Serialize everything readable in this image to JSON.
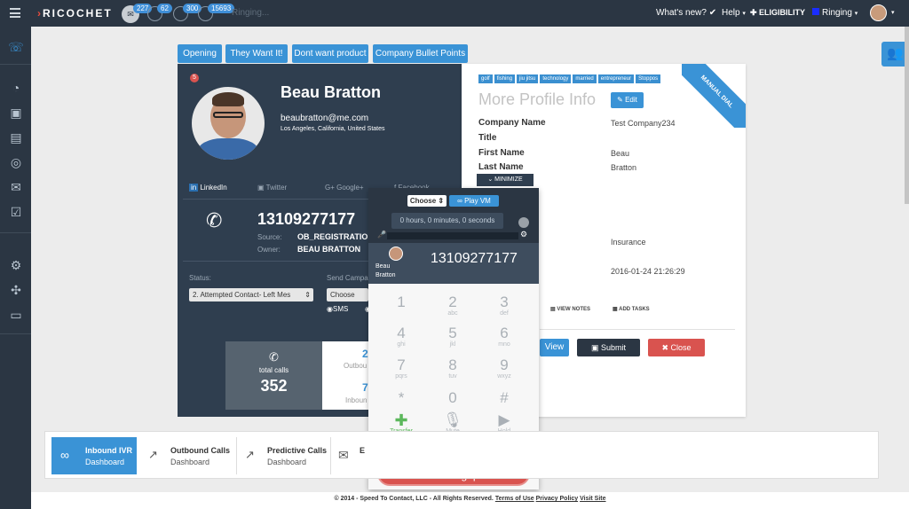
{
  "topbar": {
    "logo": "RICOCHET",
    "status_text": "Ringing...",
    "badges": [
      "227",
      "62",
      "300",
      "15693"
    ],
    "whats_new": "What's new?",
    "help": "Help",
    "eligibility": "ELIGIBILITY",
    "ringing": "Ringing"
  },
  "tabs": [
    "Opening",
    "They Want It!",
    "Dont want product",
    "Company Bullet Points"
  ],
  "profile": {
    "notif": "5",
    "name": "Beau Bratton",
    "email": "beaubratton@me.com",
    "location": "Los Angeles, California, United States",
    "socials": [
      "LinkedIn",
      "Twitter",
      "Google+",
      "Facebook"
    ],
    "phone": "13109277177",
    "source_label": "Source:",
    "source_value": "OB_REGISTRATION",
    "owner_label": "Owner:",
    "owner_value": "BEAU BRATTON",
    "status_label": "Status:",
    "status_value": "2. Attempted Contact- Left Mes",
    "send_label": "Send Campa",
    "choose": "Choose",
    "sms": "SMS",
    "total_calls_label": "total calls",
    "total_calls_value": "352",
    "outbound_label": "Outbou",
    "outbound_value": "2",
    "inbound_label": "Inboun",
    "inbound_value": "7"
  },
  "more": {
    "title": "More Profile Info",
    "edit": "Edit",
    "ribbon": "MANUAL DIAL",
    "tags": [
      "golf",
      "fishing",
      "jiu jitsu",
      "technology",
      "married",
      "entrepreneur",
      "Stoppos"
    ],
    "company_label": "Company Name",
    "company_value": "Test Company234",
    "title_label": "Title",
    "first_label": "First Name",
    "first_value": "Beau",
    "last_label": "Last Name",
    "last_value": "Bratton",
    "minimize": "MINIMIZE",
    "industry_value": "Insurance",
    "date_value": "2016-01-24 21:26:29",
    "view_notes": "VIEW NOTES",
    "add_tasks": "ADD TASKS",
    "view_btn": "View",
    "submit_btn": "Submit",
    "close_btn": "Close"
  },
  "dialer": {
    "choose": "Choose",
    "play_vm": "Play VM",
    "timer": "0 hours, 0 minutes, 0 seconds",
    "contact_name": "Beau Bratton",
    "number": "13109277177",
    "keys": [
      {
        "d": "1",
        "l": ""
      },
      {
        "d": "2",
        "l": "abc"
      },
      {
        "d": "3",
        "l": "def"
      },
      {
        "d": "4",
        "l": "ghi"
      },
      {
        "d": "5",
        "l": "jkl"
      },
      {
        "d": "6",
        "l": "mno"
      },
      {
        "d": "7",
        "l": "pqrs"
      },
      {
        "d": "8",
        "l": "tuv"
      },
      {
        "d": "9",
        "l": "wxyz"
      },
      {
        "d": "*",
        "l": ""
      },
      {
        "d": "0",
        "l": ""
      },
      {
        "d": "#",
        "l": ""
      }
    ],
    "transfer": "Transfer",
    "mute": "Mute",
    "hold": "Hold",
    "hangup": "Hangup"
  },
  "dashboard": [
    {
      "title": "Inbound IVR",
      "sub": "Dashboard"
    },
    {
      "title": "Outbound Calls",
      "sub": "Dashboard"
    },
    {
      "title": "Predictive Calls",
      "sub": "Dashboard"
    },
    {
      "title": "E",
      "sub": ""
    }
  ],
  "footer": {
    "copyright": "© 2014 - Speed To Contact, LLC - All Rights Reserved.",
    "terms": "Terms of Use",
    "privacy": "Privacy Policy",
    "visit": "Visit Site"
  },
  "colors": {
    "dark": "#2b3643",
    "card": "#2f3e4f",
    "accent": "#3a93d6",
    "danger": "#d9534f"
  }
}
